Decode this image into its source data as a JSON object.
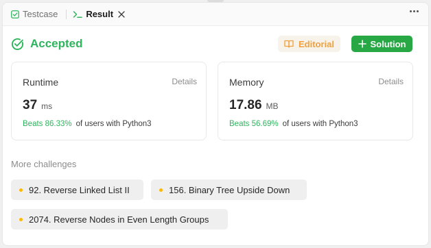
{
  "tabs": {
    "testcase_label": "Testcase",
    "result_label": "Result"
  },
  "status": {
    "label": "Accepted",
    "color": "#2db55d"
  },
  "buttons": {
    "editorial_label": "Editorial",
    "solution_label": "Solution",
    "editorial_color": "#f0a03c",
    "solution_bg": "#28a745"
  },
  "runtime": {
    "title": "Runtime",
    "details_label": "Details",
    "value": "37",
    "unit": "ms",
    "beats": "Beats 86.33%",
    "beats_suffix": "of users with Python3"
  },
  "memory": {
    "title": "Memory",
    "details_label": "Details",
    "value": "17.86",
    "unit": "MB",
    "beats": "Beats 56.69%",
    "beats_suffix": "of users with Python3"
  },
  "challenges": {
    "heading": "More challenges",
    "items": [
      "92. Reverse Linked List II",
      "156. Binary Tree Upside Down",
      "2074. Reverse Nodes in Even Length Groups"
    ]
  },
  "icons": {
    "testcase": "checkbox-icon",
    "result": "terminal-prompt-icon",
    "close": "close-icon",
    "more": "more-horizontal-icon",
    "accepted": "check-circle-icon",
    "editorial": "book-open-icon",
    "solution": "plus-icon",
    "chip": "dot-icon"
  }
}
